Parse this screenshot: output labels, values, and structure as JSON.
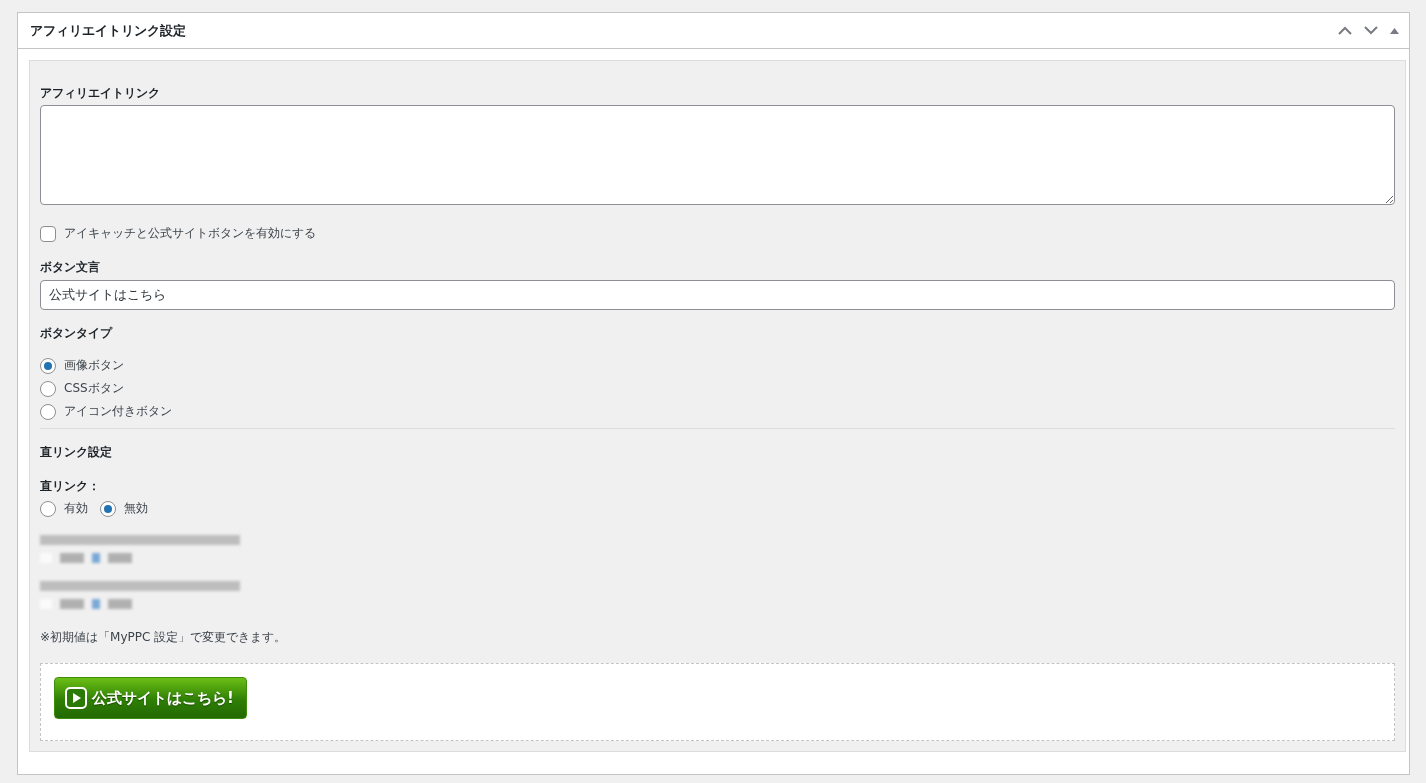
{
  "panel": {
    "title": "アフィリエイトリンク設定"
  },
  "affiliate_link": {
    "label": "アフィリエイトリンク"
  },
  "eyecatch": {
    "label": "アイキャッチと公式サイトボタンを有効にする",
    "checked": false
  },
  "button_text": {
    "label": "ボタン文言",
    "value": "公式サイトはこちら"
  },
  "button_type": {
    "label": "ボタンタイプ",
    "options": [
      {
        "label": "画像ボタン",
        "selected": true
      },
      {
        "label": "CSSボタン",
        "selected": false
      },
      {
        "label": "アイコン付きボタン",
        "selected": false
      }
    ]
  },
  "direct_link": {
    "heading": "直リンク設定",
    "label": "直リンク：",
    "options": [
      {
        "label": "有効",
        "selected": false
      },
      {
        "label": "無効",
        "selected": true
      }
    ]
  },
  "blurred_settings": [
    {
      "kind": "blurred"
    },
    {
      "kind": "blurred"
    }
  ],
  "note": "※初期値は「MyPPC 設定」で変更できます。",
  "preview": {
    "button_label": "公式サイトはこちら!"
  }
}
